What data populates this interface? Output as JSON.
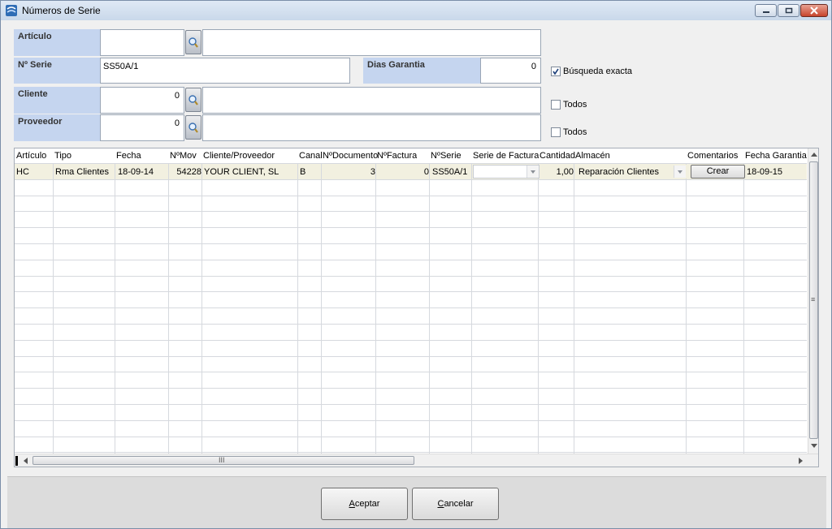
{
  "window": {
    "title": "Números de Serie",
    "icon": "app-icon",
    "controls": [
      "minimize-icon",
      "maximize-icon",
      "close-icon"
    ]
  },
  "form": {
    "articulo": {
      "label": "Artículo",
      "code": "",
      "description": ""
    },
    "nserie": {
      "label": "Nº Serie",
      "value": "SS50A/1"
    },
    "dias_garantia": {
      "label": "Dias Garantia",
      "value": "0"
    },
    "busqueda_exacta": {
      "label": "Búsqueda exacta",
      "checked": true
    },
    "cliente": {
      "label": "Cliente",
      "code": "0",
      "description": "",
      "todos_label": "Todos",
      "todos_checked": false
    },
    "proveedor": {
      "label": "Proveedor",
      "code": "0",
      "description": "",
      "todos_label": "Todos",
      "todos_checked": false
    }
  },
  "grid": {
    "columns": [
      "Artículo",
      "Tipo",
      "Fecha",
      "NºMov",
      "Cliente/Proveedor",
      "Canal",
      "NºDocumento",
      "NºFactura",
      "NºSerie",
      "Serie de Factura",
      "Cantidad",
      "Almacén",
      "Comentarios",
      "Fecha Garantia"
    ],
    "rows": [
      {
        "articulo": "HC",
        "tipo": "Rma Clientes",
        "fecha": "18-09-14",
        "nmov": "54228",
        "cliente_proveedor": "YOUR CLIENT, SL",
        "canal": "B",
        "ndocumento": "3",
        "nfactura": "0",
        "nserie": "SS50A/1",
        "serie_factura": "",
        "cantidad": "1,00",
        "almacen": "Reparación Clientes",
        "comentarios_button": "Crear",
        "fecha_garantia": "18-09-15"
      }
    ],
    "hscroll_mark": "III",
    "vscroll_mark": "≡"
  },
  "buttons": {
    "aceptar_first": "A",
    "aceptar_rest": "ceptar",
    "cancelar_first": "C",
    "cancelar_rest": "ancelar"
  }
}
